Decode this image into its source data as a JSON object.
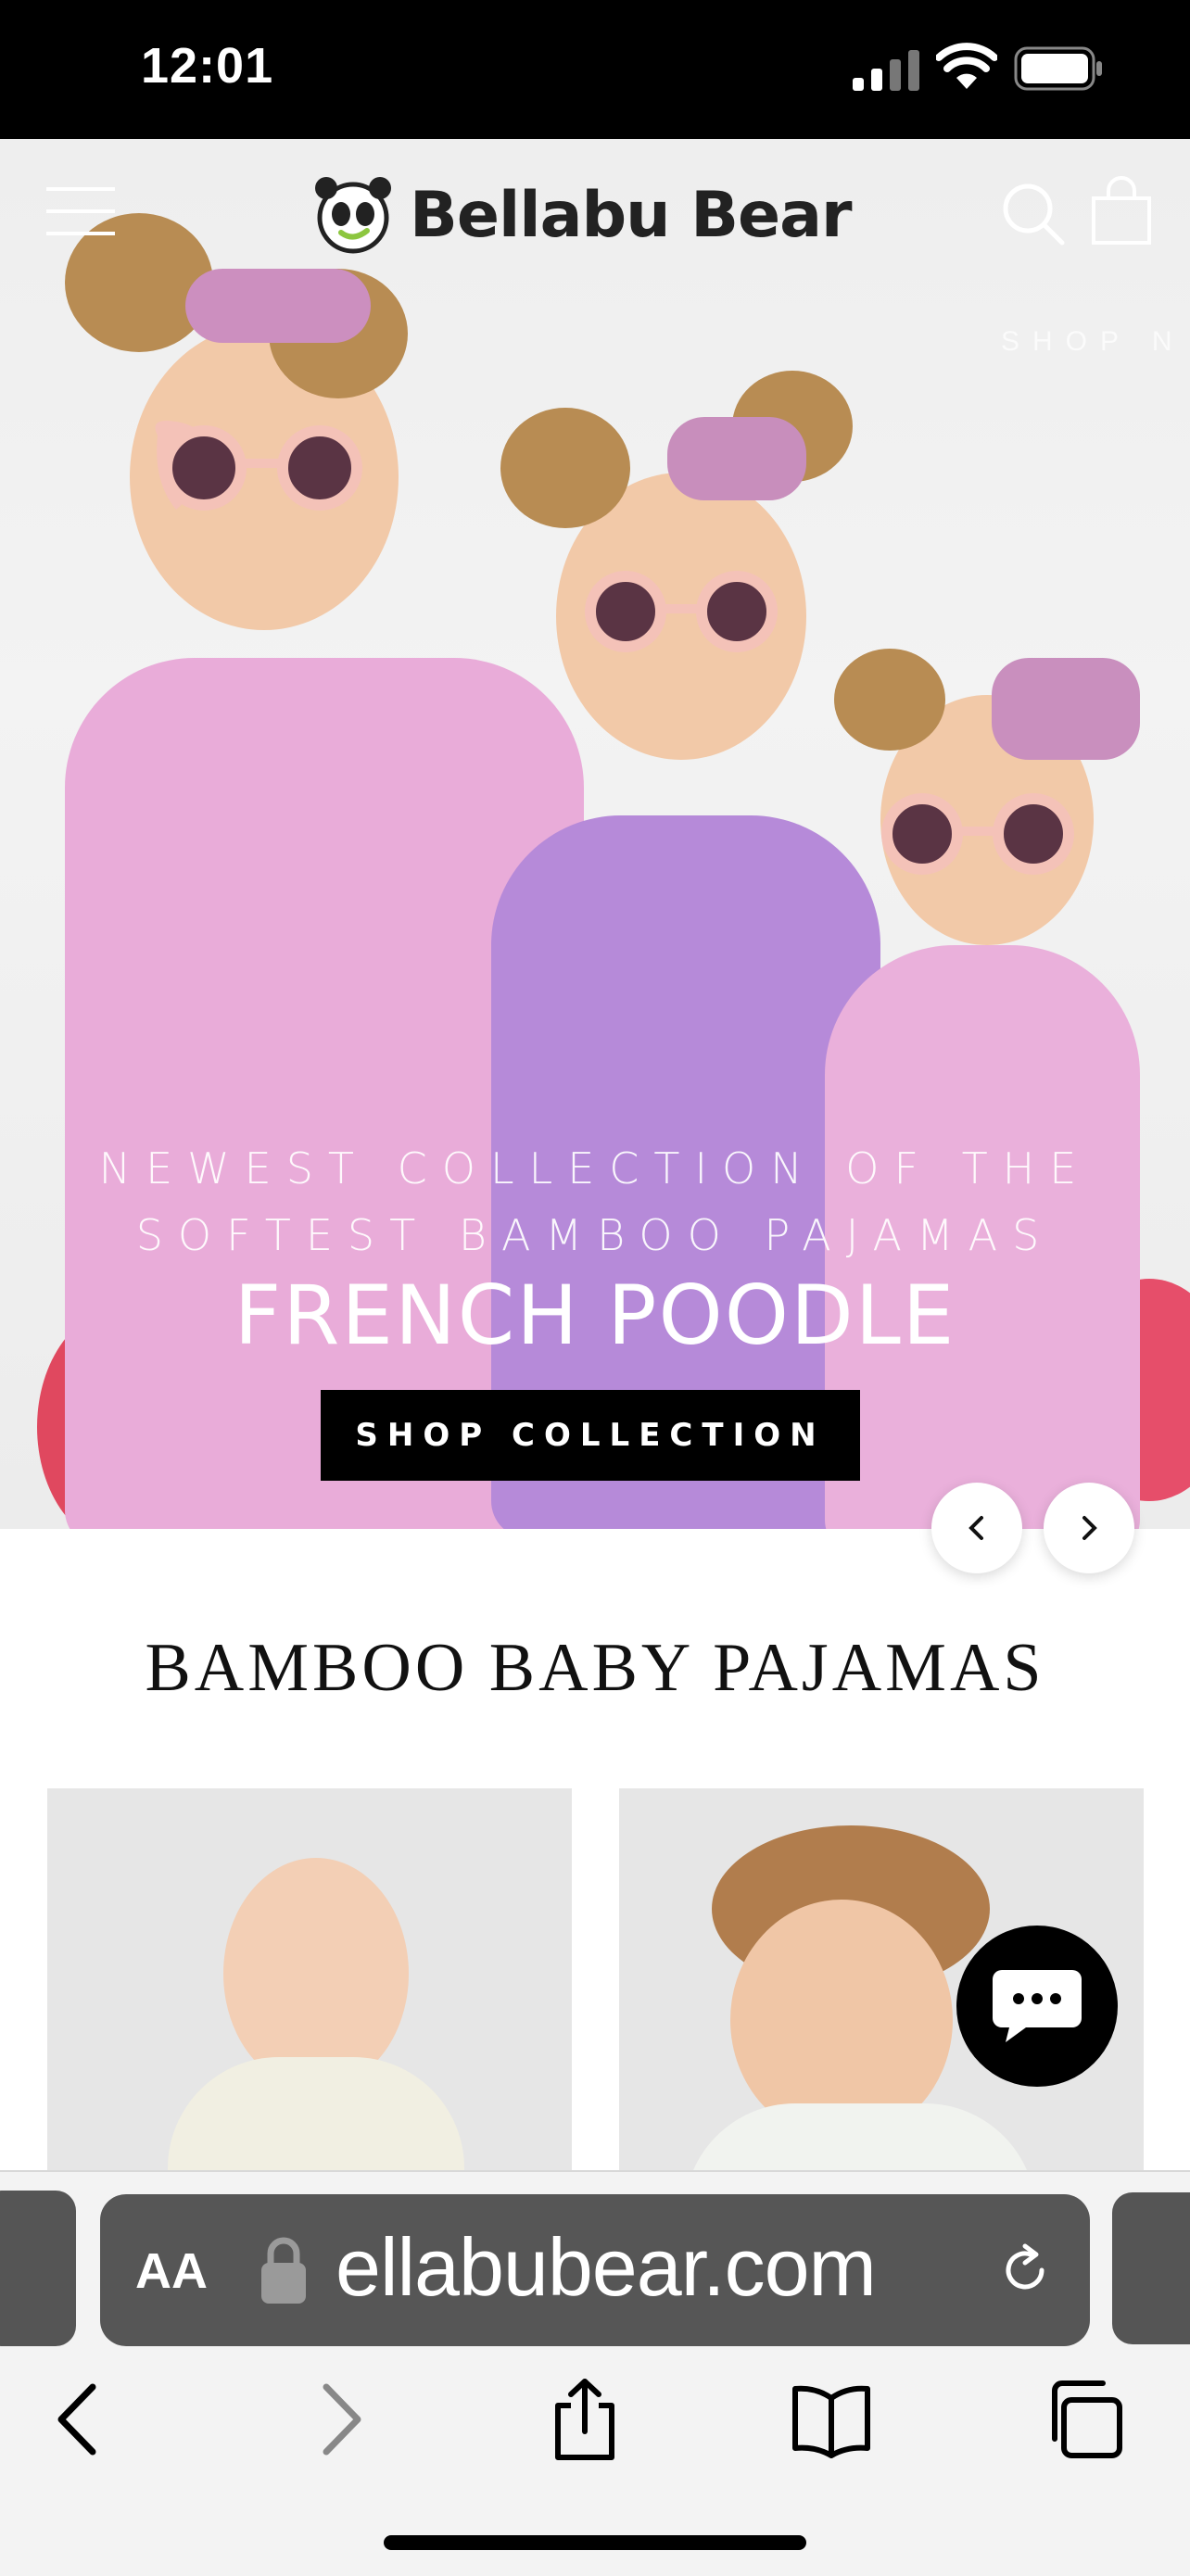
{
  "status_bar": {
    "time": "12:01"
  },
  "site": {
    "brand": "Bellabu Bear",
    "hero": {
      "ghost_text": "SHOP N",
      "subtitle_line1": "NEWEST COLLECTION OF THE",
      "subtitle_line2": "SOFTEST BAMBOO PAJAMAS",
      "title": "FRENCH POODLE",
      "cta": "SHOP COLLECTION"
    },
    "section_title": "BAMBOO BABY PAJAMAS"
  },
  "browser": {
    "text_size_label": "AA",
    "url": "ellabubear.com"
  },
  "colors": {
    "pajama_pink": "#e8a9d8",
    "pajama_lavender": "#b58ad8",
    "cta_bg": "#000000"
  }
}
